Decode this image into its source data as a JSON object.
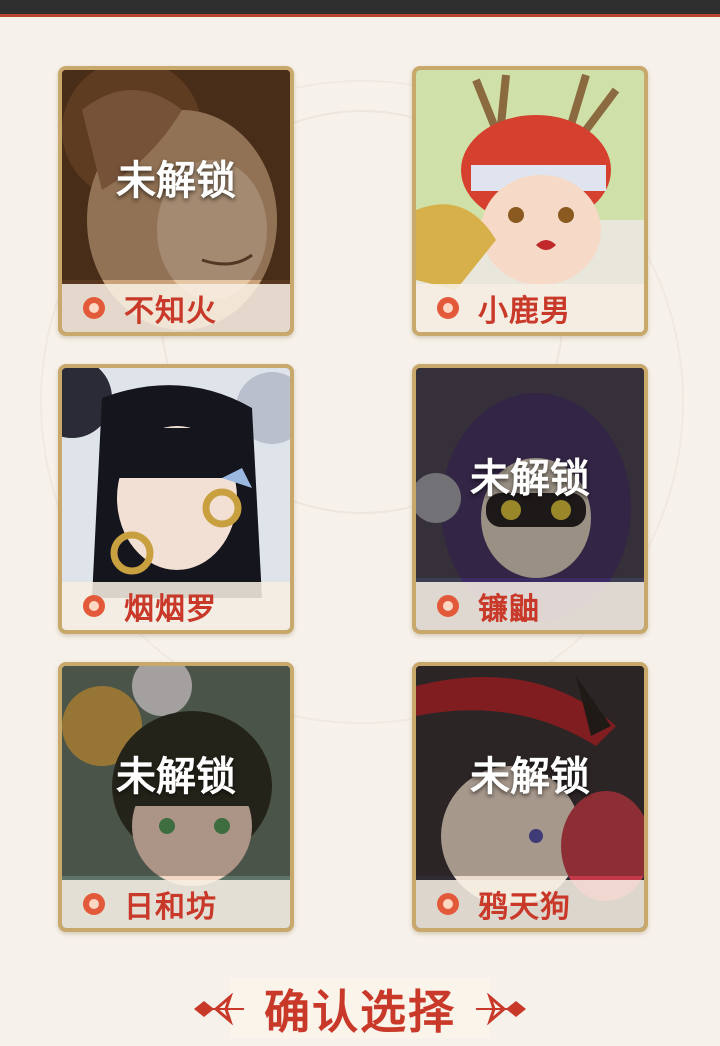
{
  "locked_label": "未解锁",
  "characters": [
    {
      "name": "不知火",
      "locked": true
    },
    {
      "name": "小鹿男",
      "locked": false
    },
    {
      "name": "烟烟罗",
      "locked": false
    },
    {
      "name": "镰鼬",
      "locked": true
    },
    {
      "name": "日和坊",
      "locked": true
    },
    {
      "name": "鸦天狗",
      "locked": true
    }
  ],
  "confirm_button": {
    "label": "确认选择"
  },
  "colors": {
    "accent": "#c9392a",
    "card_border": "#c9a86b",
    "background": "#f6f1ea",
    "top_bar": "#2f2f2f"
  }
}
